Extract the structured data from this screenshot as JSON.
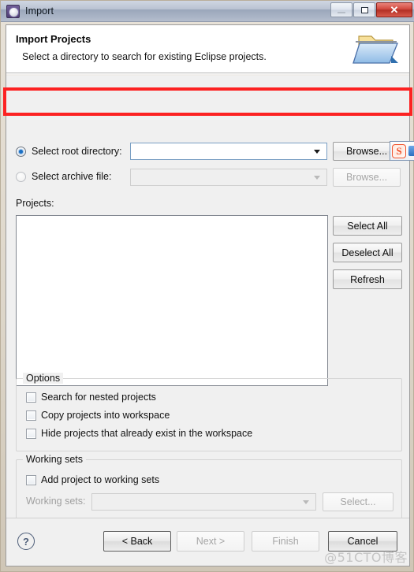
{
  "window": {
    "title": "Import",
    "icon": "gear-icon",
    "controls": {
      "minimize": "–",
      "maximize": "❐",
      "close": "✕"
    }
  },
  "banner": {
    "title": "Import Projects",
    "subtitle": "Select a directory to search for existing Eclipse projects.",
    "icon": "open-folder-icon"
  },
  "source": {
    "root_directory": {
      "label": "Select root directory:",
      "selected": true,
      "value": "",
      "placeholder": "",
      "browse_label": "Browse...",
      "browse_enabled": true
    },
    "archive_file": {
      "label": "Select archive file:",
      "selected": false,
      "value": "",
      "placeholder": "",
      "browse_label": "Browse...",
      "browse_enabled": false
    }
  },
  "projects": {
    "label": "Projects:",
    "items": [],
    "buttons": [
      {
        "label": "Select All",
        "enabled": true
      },
      {
        "label": "Deselect All",
        "enabled": true
      },
      {
        "label": "Refresh",
        "enabled": true
      }
    ]
  },
  "options": {
    "title": "Options",
    "items": [
      {
        "label": "Search for nested projects",
        "checked": false,
        "enabled": true
      },
      {
        "label": "Copy projects into workspace",
        "checked": false,
        "enabled": true
      },
      {
        "label": "Hide projects that already exist in the workspace",
        "checked": false,
        "enabled": true
      }
    ]
  },
  "working_sets": {
    "title": "Working sets",
    "add_checkbox": {
      "label": "Add project to working sets",
      "checked": false,
      "enabled": true
    },
    "field_label": "Working sets:",
    "field_value": "",
    "field_enabled": false,
    "select_label": "Select...",
    "select_enabled": false
  },
  "footer": {
    "help_icon": "?",
    "buttons": [
      {
        "label": "< Back",
        "enabled": true,
        "default": true
      },
      {
        "label": "Next >",
        "enabled": false,
        "default": false
      },
      {
        "label": "Finish",
        "enabled": false,
        "default": false
      },
      {
        "label": "Cancel",
        "enabled": true,
        "default": false
      }
    ]
  },
  "overlays": {
    "highlight_color": "#fc2222",
    "watermark": "@51CTO博客",
    "ime_label": "S"
  }
}
